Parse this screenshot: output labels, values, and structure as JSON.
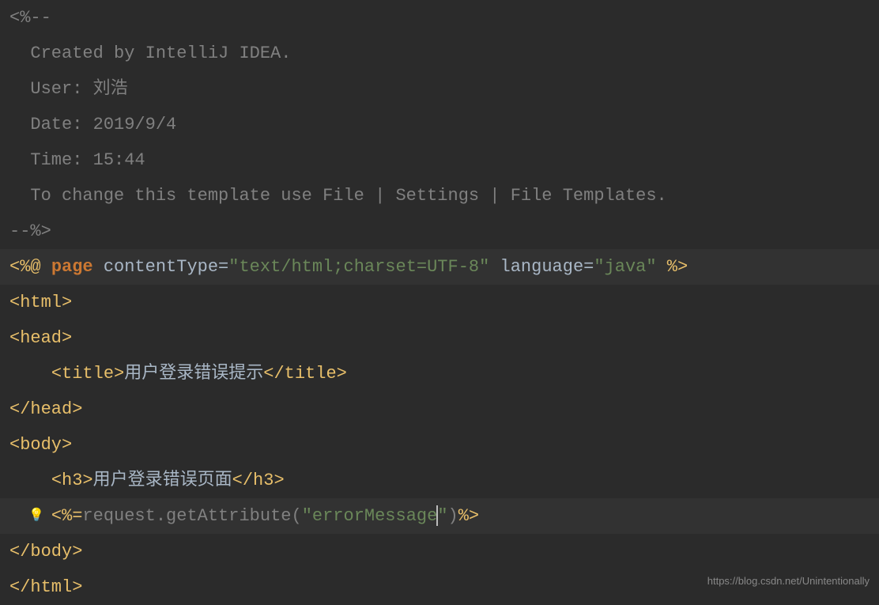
{
  "lines": {
    "l1": "<%--",
    "l2": "  Created by IntelliJ IDEA.",
    "l3": "  User: 刘浩",
    "l4": "  Date: 2019/9/4",
    "l5": "  Time: 15:44",
    "l6": "  To change this template use File | Settings | File Templates.",
    "l7": "--%>",
    "l8_open": "<%@ ",
    "l8_page": "page",
    "l8_contentType": " contentType=",
    "l8_ct_value": "\"text/html;charset=UTF-8\"",
    "l8_language": " language=",
    "l8_lang_value": "\"java\"",
    "l8_close": " %>",
    "l9_open": "<",
    "l9_tag": "html",
    "l9_close": ">",
    "l10_open": "<",
    "l10_tag": "head",
    "l10_close": ">",
    "l11_indent": "    ",
    "l11_open": "<",
    "l11_tag": "title",
    "l11_close": ">",
    "l11_text": "用户登录错误提示",
    "l11_end_open": "</",
    "l11_end_tag": "title",
    "l11_end_close": ">",
    "l12_open": "</",
    "l12_tag": "head",
    "l12_close": ">",
    "l13_open": "<",
    "l13_tag": "body",
    "l13_close": ">",
    "l14_indent": "    ",
    "l14_open": "<",
    "l14_tag": "h3",
    "l14_close": ">",
    "l14_text": "用户登录错误页面",
    "l14_end_open": "</",
    "l14_end_tag": "h3",
    "l14_end_close": ">",
    "l15_indent": "    ",
    "l15_open": "<%=",
    "l15_request": "request",
    "l15_method": ".getAttribute(",
    "l15_string": "\"errorMessage",
    "l15_string2": "\"",
    "l15_close_paren": ")",
    "l15_close": "%>",
    "l16_open": "</",
    "l16_tag": "body",
    "l16_close": ">",
    "l17_open": "</",
    "l17_tag": "html",
    "l17_close": ">"
  },
  "watermark": "https://blog.csdn.net/Unintentionally",
  "bulb": "💡"
}
